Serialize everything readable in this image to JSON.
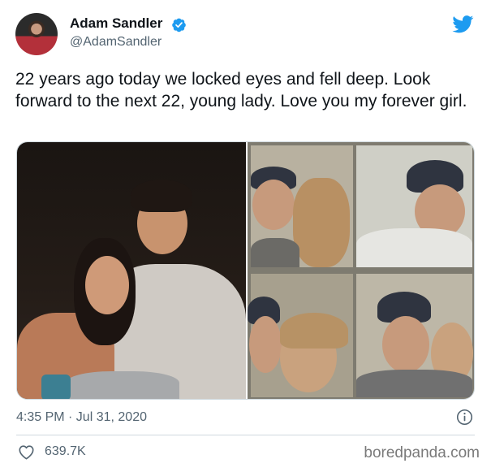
{
  "author": {
    "display_name": "Adam Sandler",
    "handle": "@AdamSandler",
    "verified": true
  },
  "tweet": {
    "text": "22 years ago today we locked eyes and fell deep. Look forward to the next 22, young lady. Love you my forever girl.",
    "timestamp": "4:35 PM · Jul 31, 2020",
    "likes": "639.7K"
  },
  "media": {
    "images": [
      "couple-photo",
      "photo-booth-strip"
    ]
  },
  "icons": {
    "verified": "verified-badge-icon",
    "brand": "twitter-bird-icon",
    "info": "info-icon",
    "like": "heart-icon"
  },
  "colors": {
    "twitter_blue": "#1d9bf0",
    "secondary_text": "#536471",
    "primary_text": "#0f1419"
  },
  "watermark": "boredpanda.com"
}
